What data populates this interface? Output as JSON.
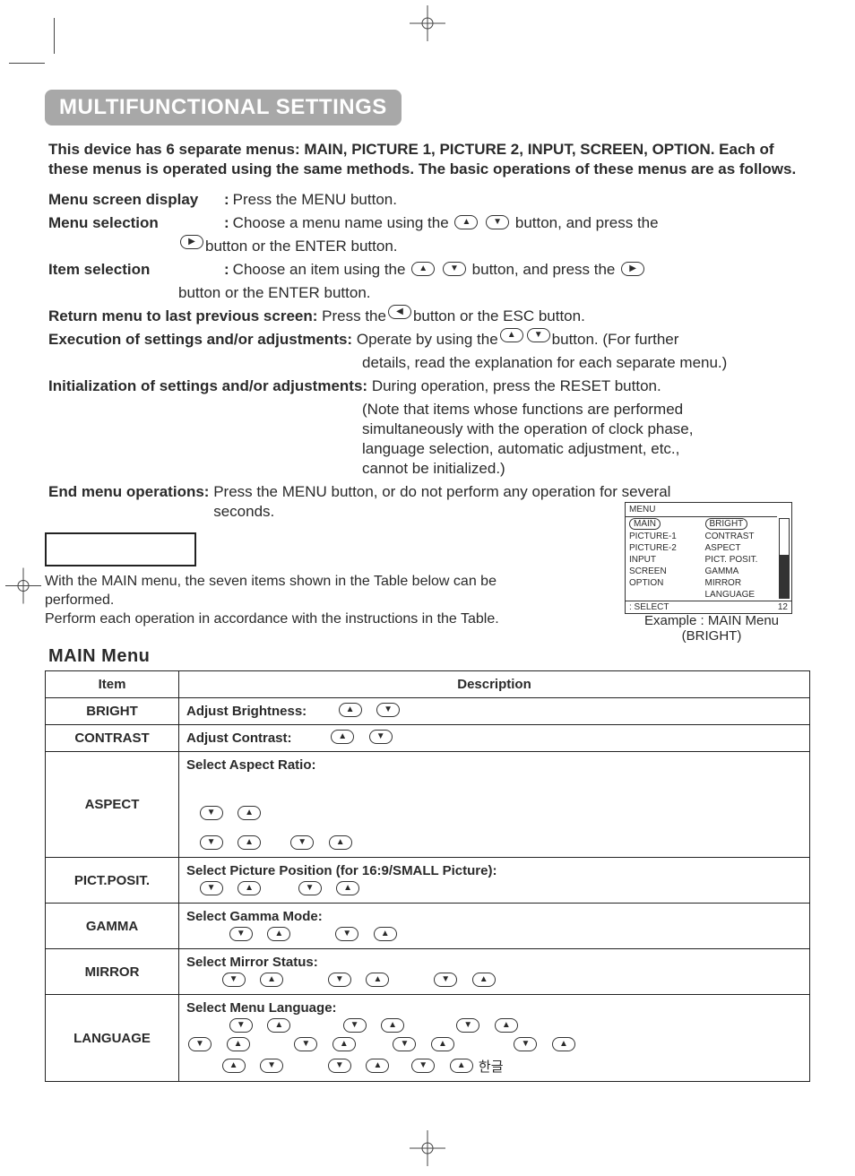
{
  "title": "MULTIFUNCTIONAL SETTINGS",
  "intro": "This device has 6 separate menus: MAIN, PICTURE 1, PICTURE 2, INPUT, SCREEN, OPTION. Each of these menus is operated using the same methods. The basic operations of these menus are as follows.",
  "ops": {
    "menu_screen_display": {
      "label": "Menu screen display",
      "text1": "Press the  MENU  button."
    },
    "menu_selection": {
      "label": "Menu selection",
      "text1": "Choose a menu name using the ",
      "text2": " button, and press the",
      "text3": " button or the ENTER button."
    },
    "item_selection": {
      "label": "Item selection",
      "text1": "Choose an item using the ",
      "text2": " button, and press the ",
      "text3": "button or the ENTER button."
    },
    "return": {
      "label": "Return menu to last previous screen:",
      "text1": "Press the ",
      "text2": "button or the ESC button."
    },
    "exec": {
      "label": "Execution of settings and/or adjustments:",
      "text1": "Operate by using the ",
      "text2": " button. (For further",
      "text3": "details, read the explanation for each separate menu.)"
    },
    "init": {
      "label": "Initialization of settings and/or adjustments:",
      "text1": "During operation, press the RESET button.",
      "text2": "(Note that items whose functions are performed simultaneously with the operation of clock phase, language selection, automatic adjustment, etc., cannot be initialized.)"
    },
    "end": {
      "label": "End menu operations:",
      "text1": "Press the MENU button, or do not perform any operation for several seconds."
    }
  },
  "sub_intro1": "With the MAIN menu, the seven items shown in the Table below can be performed.",
  "sub_intro2": "Perform each operation in accordance with the instructions in the Table.",
  "osd": {
    "title": "MENU",
    "left": [
      "MAIN",
      "PICTURE-1",
      "PICTURE-2",
      "INPUT",
      "SCREEN",
      "OPTION"
    ],
    "right": [
      "BRIGHT",
      "CONTRAST",
      "ASPECT",
      "PICT. POSIT.",
      "GAMMA",
      "MIRROR",
      "LANGUAGE"
    ],
    "foot_left": ": SELECT",
    "foot_right": "12",
    "caption1": "Example : MAIN Menu",
    "caption2": "(BRIGHT)"
  },
  "main_menu_title": "MAIN Menu",
  "table": {
    "head_item": "Item",
    "head_desc": "Description",
    "rows": {
      "bright": {
        "item": "BRIGHT",
        "lead": "Adjust Brightness:"
      },
      "contrast": {
        "item": "CONTRAST",
        "lead": "Adjust Contrast:"
      },
      "aspect": {
        "item": "ASPECT",
        "lead": "Select Aspect Ratio:"
      },
      "pict": {
        "item": "PICT.POSIT.",
        "lead": "Select Picture Position (for 16:9/SMALL Picture):"
      },
      "gamma": {
        "item": "GAMMA",
        "lead": "Select Gamma Mode:"
      },
      "mirror": {
        "item": "MIRROR",
        "lead": "Select Mirror Status:"
      },
      "lang": {
        "item": "LANGUAGE",
        "lead": "Select Menu Language:",
        "kor": "한글"
      }
    }
  }
}
